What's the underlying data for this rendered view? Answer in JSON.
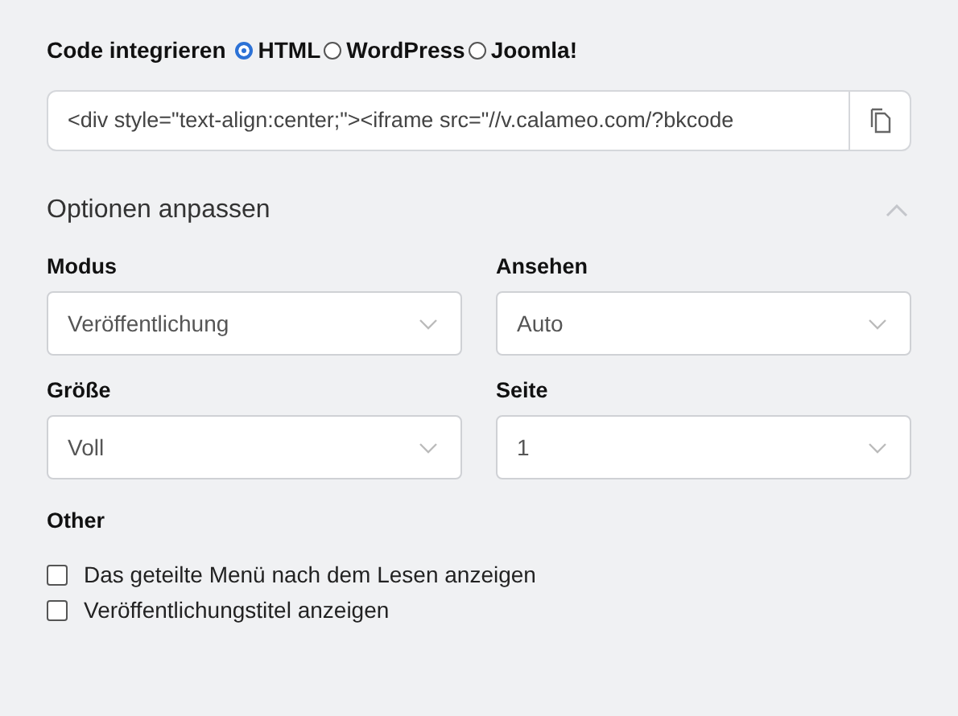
{
  "embed": {
    "label": "Code integrieren",
    "formats": [
      {
        "label": "HTML",
        "selected": true
      },
      {
        "label": "WordPress",
        "selected": false
      },
      {
        "label": "Joomla!",
        "selected": false
      }
    ],
    "code": "<div style=\"text-align:center;\"><iframe src=\"//v.calameo.com/?bkcode"
  },
  "options": {
    "title": "Optionen anpassen",
    "expanded": true,
    "fields": [
      {
        "label": "Modus",
        "value": "Veröffentlichung"
      },
      {
        "label": "Ansehen",
        "value": "Auto"
      },
      {
        "label": "Größe",
        "value": "Voll"
      },
      {
        "label": "Seite",
        "value": "1"
      }
    ],
    "other_label": "Other",
    "checkboxes": [
      {
        "label": "Das geteilte Menü nach dem Lesen anzeigen",
        "checked": false
      },
      {
        "label": "Veröffentlichungstitel anzeigen",
        "checked": false
      }
    ]
  }
}
